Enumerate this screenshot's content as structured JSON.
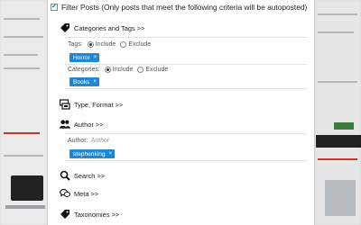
{
  "filter_posts": {
    "checked": true,
    "label": "Filter Posts (Only posts that meet the following criteria will be autoposted)"
  },
  "sections": {
    "categories_tags": {
      "label": "Categories and Tags >>"
    },
    "tags_field": {
      "label": "Tags:",
      "include": "Include",
      "exclude": "Exclude",
      "selected": "include",
      "chip": "Horror"
    },
    "categories_field": {
      "label": "Categories:",
      "include": "Include",
      "exclude": "Exclude",
      "selected": "include",
      "chip": "Books"
    },
    "type_format": {
      "label": "Type, Format >>"
    },
    "author": {
      "label": "Author >>"
    },
    "author_field": {
      "label": "Author:",
      "placeholder": "Author",
      "chip": "stephenking"
    },
    "search": {
      "label": "Search >>"
    },
    "meta": {
      "label": "Meta >>"
    },
    "taxonomies": {
      "label": "Taxonomies >>"
    }
  },
  "chip_remove_glyph": "×",
  "check_glyph": "✔",
  "colors": {
    "chip_bg": "#1e88d8",
    "panel_bg": "#ffffff"
  },
  "icons": [
    "tag-icon",
    "type-format-icon",
    "users-icon",
    "search-icon",
    "comment-icon"
  ]
}
